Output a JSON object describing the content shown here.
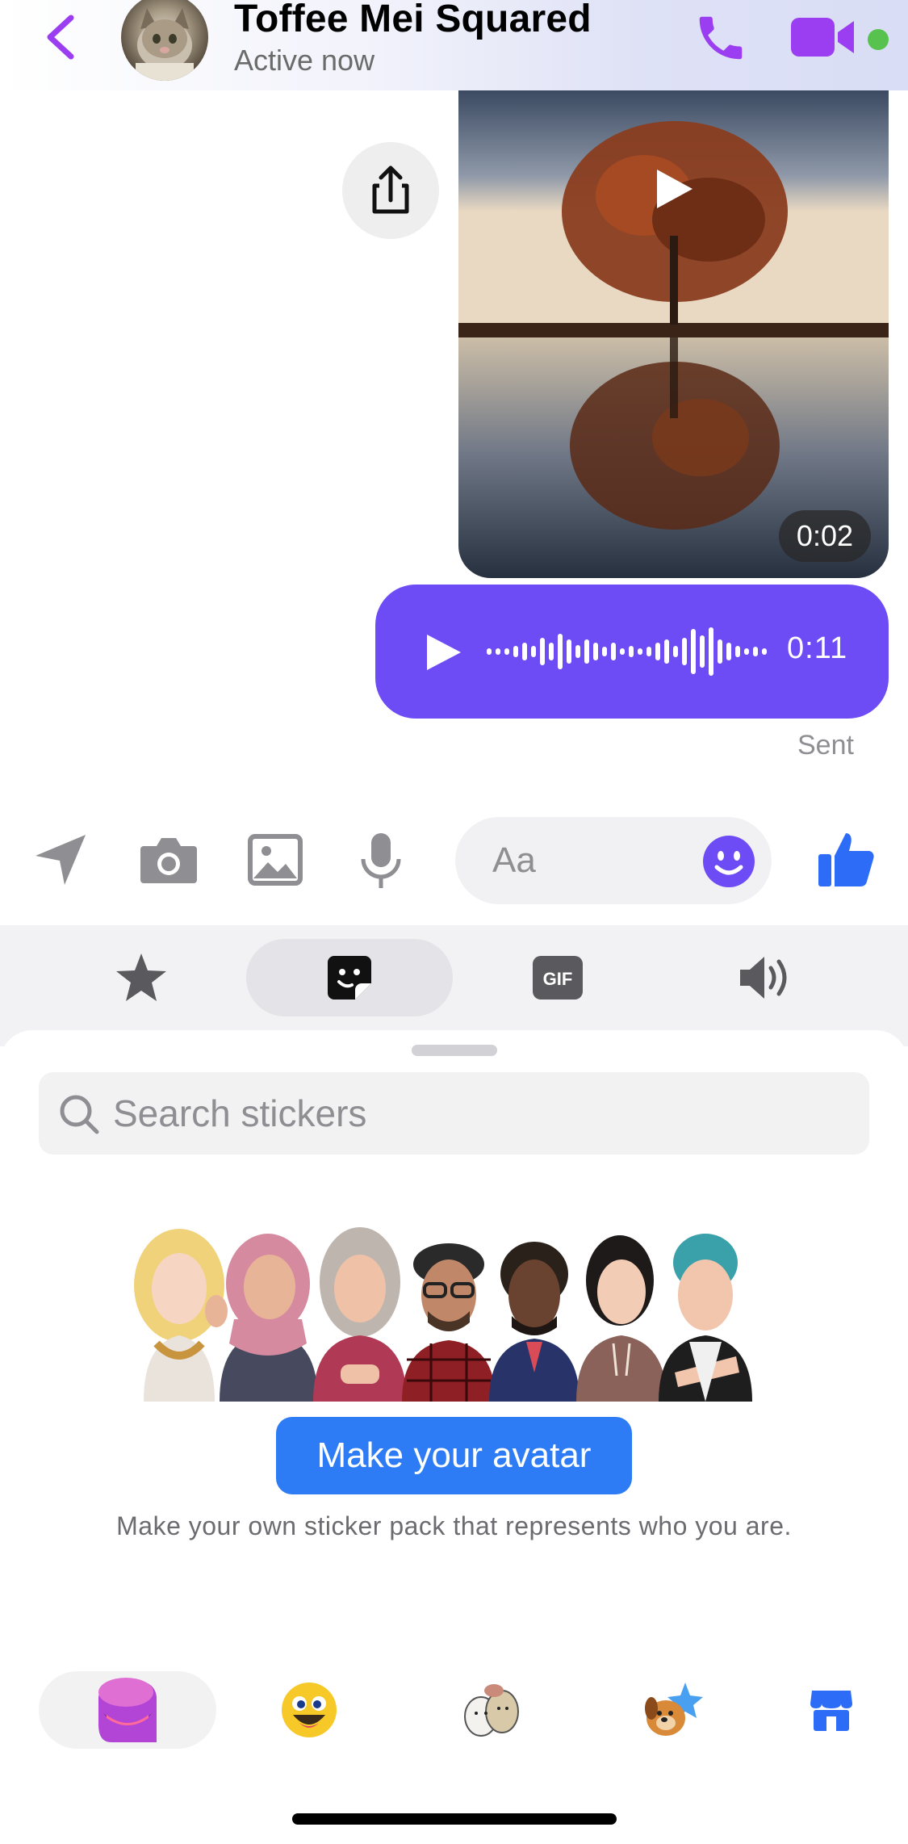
{
  "header": {
    "contact_name": "Toffee Mei Squared",
    "status": "Active now"
  },
  "messages": {
    "video_duration": "0:02",
    "voice_duration": "0:11",
    "delivery_status": "Sent"
  },
  "composer": {
    "placeholder": "Aa"
  },
  "tray_tabs": [
    {
      "icon": "star-icon"
    },
    {
      "icon": "sticker-icon",
      "active": true
    },
    {
      "icon": "gif-icon",
      "label": "GIF"
    },
    {
      "icon": "speaker-icon"
    }
  ],
  "stickers": {
    "search_placeholder": "Search stickers",
    "make_avatar_label": "Make your avatar",
    "hint": "Make your own sticker pack that represents who you are."
  },
  "sticker_packs": [
    {
      "icon": "avatar-pack-icon",
      "active": true
    },
    {
      "icon": "emoji-pack-icon"
    },
    {
      "icon": "cartoon-pack-icon"
    },
    {
      "icon": "dog-pack-icon"
    },
    {
      "icon": "store-icon"
    }
  ],
  "colors": {
    "accent_purple": "#9b3df0",
    "voice_bubble": "#6e4cf5",
    "button_blue": "#2d7cf6",
    "online": "#57c24d"
  }
}
